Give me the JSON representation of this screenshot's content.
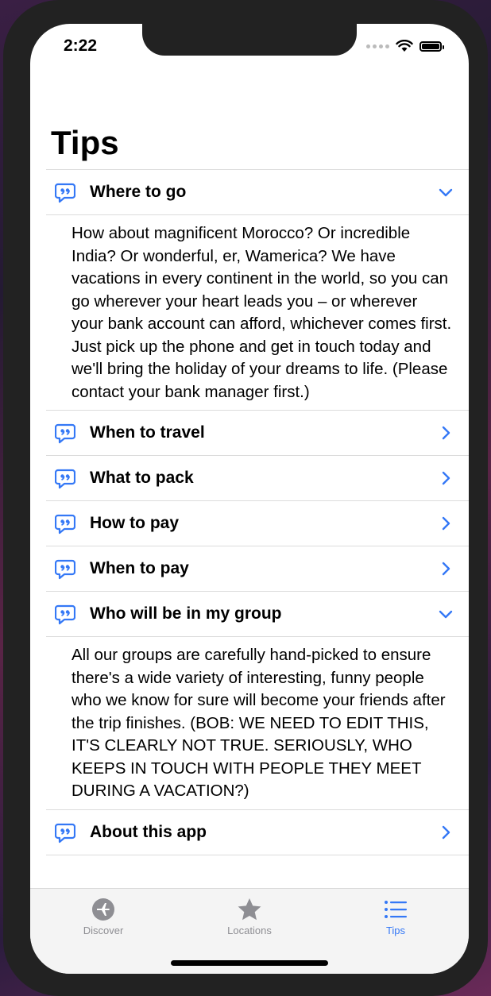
{
  "status": {
    "time": "2:22"
  },
  "page": {
    "title": "Tips"
  },
  "tips": [
    {
      "title": "Where to go",
      "expanded": true,
      "body": "How about magnificent Morocco? Or incredible India? Or wonderful, er, Wamerica? We have vacations in every continent in the world, so you can go wherever your heart leads you – or wherever your bank account can afford, whichever comes first. Just pick up the phone and get in touch today and we'll bring the holiday of your dreams to life. (Please contact your bank manager first.)"
    },
    {
      "title": "When to travel",
      "expanded": false
    },
    {
      "title": "What to pack",
      "expanded": false
    },
    {
      "title": "How to pay",
      "expanded": false
    },
    {
      "title": "When to pay",
      "expanded": false
    },
    {
      "title": "Who will be in my group",
      "expanded": true,
      "body": "All our groups are carefully hand-picked to ensure there's a wide variety of interesting, funny people who we know for sure will become your friends after the trip finishes. (BOB: WE NEED TO EDIT THIS, IT'S CLEARLY NOT TRUE. SERIOUSLY, WHO KEEPS IN TOUCH WITH PEOPLE THEY MEET DURING A VACATION?)"
    },
    {
      "title": "About this app",
      "expanded": false
    }
  ],
  "tabbar": {
    "items": [
      {
        "label": "Discover",
        "icon": "airplane-circle-icon",
        "selected": false
      },
      {
        "label": "Locations",
        "icon": "star-icon",
        "selected": false
      },
      {
        "label": "Tips",
        "icon": "list-icon",
        "selected": true
      }
    ]
  },
  "colors": {
    "accent": "#3478f6",
    "inactive": "#8e8e93"
  }
}
